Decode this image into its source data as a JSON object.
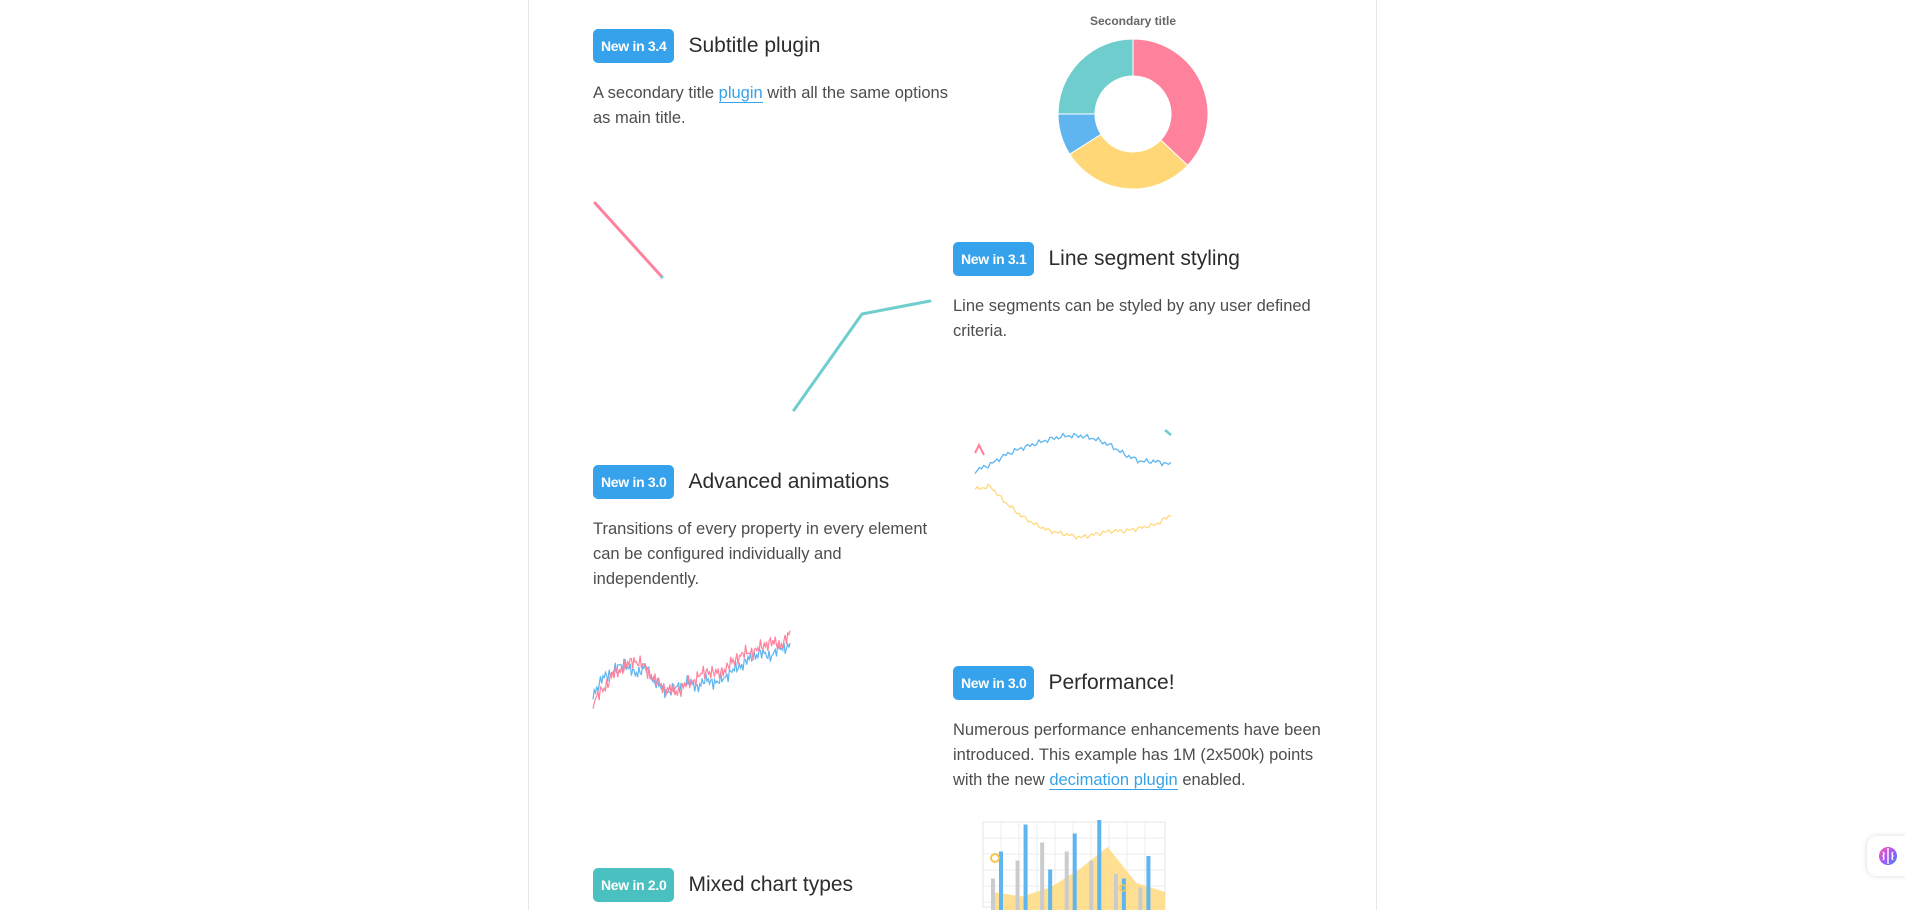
{
  "features": [
    {
      "badge": "New in 3.4",
      "title": "Subtitle plugin",
      "desc_before": "A secondary title ",
      "desc_link": "plugin",
      "desc_after": " with all the same options as main title."
    },
    {
      "badge": "New in 3.1",
      "title": "Line segment styling",
      "desc": "Line segments can be styled by any user defined criteria."
    },
    {
      "badge": "New in 3.0",
      "title": "Advanced animations",
      "desc": "Transitions of every property in every element can be configured individually and independently."
    },
    {
      "badge": "New in 3.0",
      "title": "Performance!",
      "desc_before": "Numerous performance enhancements have been introduced. This example has 1M (2x500k) points with the new ",
      "desc_link": "decimation plugin",
      "desc_after": " enabled."
    },
    {
      "badge": "New in 2.0",
      "title": "Mixed chart types"
    }
  ],
  "colors": {
    "red": "#ff829d",
    "blue": "#5eb5ef",
    "yellow": "#ffd777",
    "teal": "#6fcdcd",
    "grey": "#c9cbcf",
    "badge_blue": "#36a2eb",
    "badge_teal": "#4bc0c0"
  },
  "chart_data": [
    {
      "type": "pie",
      "subtitle": "Secondary title",
      "donut": true,
      "labels": [],
      "values": [
        37,
        29,
        9,
        25
      ],
      "colors": [
        "#ff829d",
        "#ffd777",
        "#5eb5ef",
        "#6fcdcd"
      ]
    },
    {
      "type": "line",
      "series": [
        {
          "color": "#ff829d",
          "values": [
            1,
            20
          ]
        },
        {
          "color": "#6fcdcd",
          "values": [
            16,
            20
          ]
        },
        {
          "color": "#6fcdcd",
          "values": [
            70,
            98,
            106
          ]
        }
      ]
    },
    {
      "type": "line",
      "series": [
        {
          "color": "#5eb5ef",
          "values": [
            -10,
            -6,
            0,
            4,
            7,
            10,
            12,
            12,
            10,
            6,
            0,
            -4,
            -4,
            -6
          ]
        },
        {
          "color": "#ffd777",
          "values": [
            16,
            18,
            8,
            0,
            -6,
            -10,
            -12,
            -14,
            -12,
            -10,
            -10,
            -8,
            -6,
            0
          ]
        }
      ]
    },
    {
      "type": "line",
      "series": [
        {
          "color": "#5eb5ef",
          "values": [
            -5,
            4,
            8,
            12,
            6,
            10,
            2,
            -4,
            -2,
            2,
            -1,
            3,
            1,
            6,
            10,
            14,
            18,
            16,
            20,
            22
          ]
        },
        {
          "color": "#ff829d",
          "values": [
            -10,
            -2,
            6,
            10,
            14,
            10,
            2,
            -2,
            -4,
            0,
            4,
            8,
            6,
            10,
            16,
            18,
            20,
            24,
            22,
            28
          ]
        }
      ]
    },
    {
      "type": "bar",
      "series": [
        {
          "color": "#5eb5ef",
          "values": [
            65,
            95,
            45,
            85,
            100,
            35,
            60
          ]
        },
        {
          "color": "#c9cbcf",
          "values": [
            35,
            55,
            75,
            65,
            55,
            40,
            25
          ]
        },
        {
          "color": "#ffd777",
          "values": [
            20,
            15,
            25,
            45,
            70,
            30,
            20
          ]
        }
      ]
    }
  ]
}
